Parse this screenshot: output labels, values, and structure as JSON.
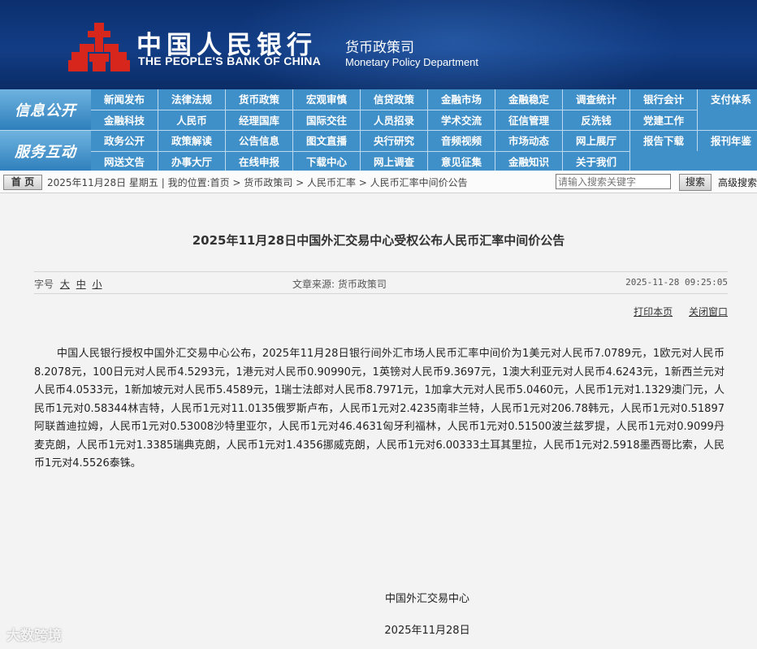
{
  "header": {
    "bank_name_cn": "中国人民银行",
    "bank_name_en": "THE PEOPLE'S BANK OF CHINA",
    "dept_cn": "货币政策司",
    "dept_en": "Monetary Policy Department"
  },
  "nav": {
    "info": {
      "label": "信息公开",
      "row1": [
        "新闻发布",
        "法律法规",
        "货币政策",
        "宏观审慎",
        "信贷政策",
        "金融市场",
        "金融稳定",
        "调查统计",
        "银行会计",
        "支付体系"
      ],
      "row2": [
        "金融科技",
        "人民币",
        "经理国库",
        "国际交往",
        "人员招录",
        "学术交流",
        "征信管理",
        "反洗钱",
        "党建工作"
      ]
    },
    "service": {
      "label": "服务互动",
      "row1": [
        "政务公开",
        "政策解读",
        "公告信息",
        "图文直播",
        "央行研究",
        "音频视频",
        "市场动态",
        "网上展厅",
        "报告下载",
        "报刊年鉴"
      ],
      "row2": [
        "网送文告",
        "办事大厅",
        "在线申报",
        "下载中心",
        "网上调查",
        "意见征集",
        "金融知识",
        "关于我们"
      ]
    }
  },
  "breadcrumb": {
    "home": "首 页",
    "text": "2025年11月28日 星期五 | 我的位置:首页 > 货币政策司 > 人民币汇率 > 人民币汇率中间价公告",
    "search_placeholder": "请输入搜索关键字",
    "search_btn": "搜索",
    "advanced": "高级搜索"
  },
  "article": {
    "title": "2025年11月28日中国外汇交易中心受权公布人民币汇率中间价公告",
    "font_size_label": "字号",
    "fs_large": "大",
    "fs_medium": "中",
    "fs_small": "小",
    "source": "文章来源: 货币政策司",
    "datetime": "2025-11-28  09:25:05",
    "print": "打印本页",
    "close": "关闭窗口",
    "body": "中国人民银行授权中国外汇交易中心公布，2025年11月28日银行间外汇市场人民币汇率中间价为1美元对人民币7.0789元，1欧元对人民币8.2078元，100日元对人民币4.5293元，1港元对人民币0.90990元，1英镑对人民币9.3697元，1澳大利亚元对人民币4.6243元，1新西兰元对人民币4.0533元，1新加坡元对人民币5.4589元，1瑞士法郎对人民币8.7971元，1加拿大元对人民币5.0460元，人民币1元对1.1329澳门元，人民币1元对0.58344林吉特，人民币1元对11.0135俄罗斯卢布，人民币1元对2.4235南非兰特，人民币1元对206.78韩元，人民币1元对0.51897阿联酋迪拉姆，人民币1元对0.53008沙特里亚尔，人民币1元对46.4631匈牙利福林，人民币1元对0.51500波兰兹罗提，人民币1元对0.9099丹麦克朗，人民币1元对1.3385瑞典克朗，人民币1元对1.4356挪威克朗，人民币1元对6.00333土耳其里拉，人民币1元对2.5918墨西哥比索，人民币1元对4.5526泰铢。",
    "signature_org": "中国外汇交易中心",
    "signature_date": "2025年11月28日"
  },
  "watermark": "大数跨境",
  "colors": {
    "header_bg": "#0c2f6e",
    "nav_bg": "#3f8fc8",
    "logo_red": "#d7261c"
  }
}
